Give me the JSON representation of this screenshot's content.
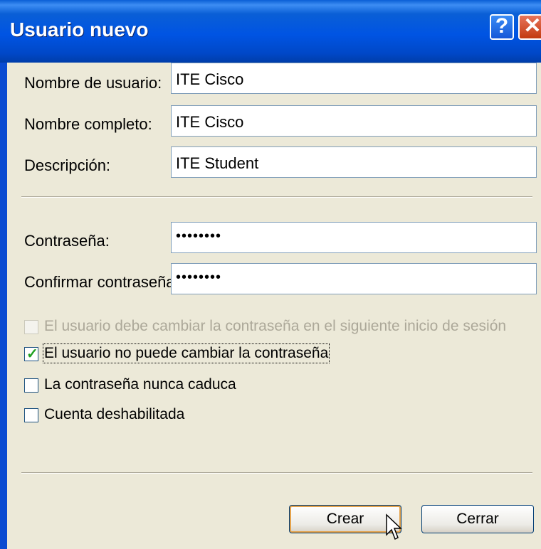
{
  "window": {
    "title": "Usuario nuevo"
  },
  "titlebar": {
    "help_label": "?",
    "close_label": "✕"
  },
  "fields": {
    "username": {
      "label": "Nombre de usuario:",
      "value": "ITE Cisco"
    },
    "fullname": {
      "label": "Nombre completo:",
      "value": "ITE Cisco"
    },
    "description": {
      "label": "Descripción:",
      "value": "ITE Student"
    },
    "password": {
      "label": "Contraseña:",
      "value": "••••••••"
    },
    "confirm": {
      "label": "Confirmar contraseña:",
      "value": "••••••••"
    }
  },
  "checkboxes": [
    {
      "label": "El usuario debe cambiar la contraseña en el siguiente inicio de sesión",
      "checked": false,
      "disabled": true
    },
    {
      "label": "El usuario no puede cambiar la contraseña",
      "checked": true,
      "disabled": false
    },
    {
      "label": "La contraseña nunca caduca",
      "checked": false,
      "disabled": false
    },
    {
      "label": "Cuenta deshabilitada",
      "checked": false,
      "disabled": false
    }
  ],
  "buttons": {
    "create": "Crear",
    "close": "Cerrar"
  },
  "colors": {
    "titlebar": "#0054e3",
    "background": "#ece9d8",
    "check": "#21a121"
  }
}
